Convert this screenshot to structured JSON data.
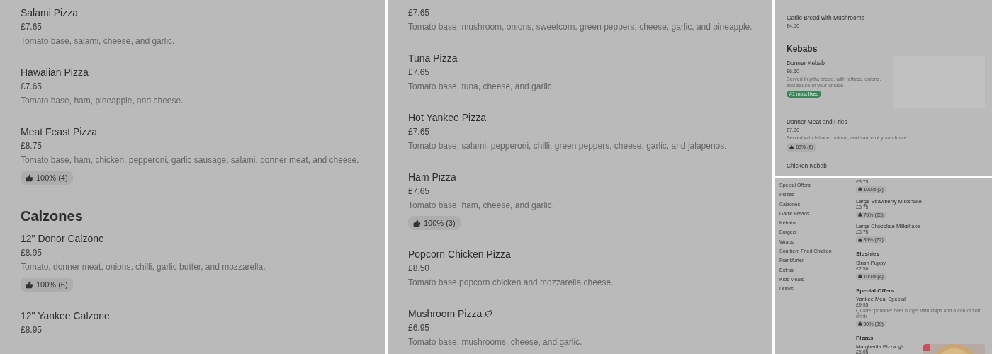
{
  "panels": [
    {
      "kind": "large",
      "sections": [
        {
          "items": [
            {
              "title": "Salami Pizza",
              "price": "£7.65",
              "description": "Tomato base, salami, cheese, and garlic.",
              "vegetarian": false
            },
            {
              "title": "Hawaiian Pizza",
              "price": "£7.65",
              "description": "Tomato base, ham, pineapple, and cheese.",
              "vegetarian": false
            },
            {
              "title": "Meat Feast Pizza",
              "price": "£8.75",
              "description": "Tomato base, ham, chicken, pepperoni, garlic sausage, salami, donner meat, and cheese.",
              "rating": "100% (4)",
              "vegetarian": false
            }
          ]
        },
        {
          "heading": "Calzones",
          "items": [
            {
              "title": "12\" Donor Calzone",
              "price": "£8.95",
              "description": "Tomato, donner meat, onions, chilli, garlic butter, and mozzarella.",
              "rating": "100% (6)",
              "vegetarian": false
            },
            {
              "title": "12\" Yankee Calzone",
              "price": "£8.95",
              "vegetarian": false
            }
          ]
        }
      ]
    },
    {
      "kind": "large",
      "sections": [
        {
          "items": [
            {
              "price": "£7.65",
              "description": "Tomato base, mushroom, onions, sweetcorn, green peppers, cheese, garlic, and pineapple."
            },
            {
              "title": "Tuna Pizza",
              "price": "£7.65",
              "description": "Tomato base, tuna, cheese, and garlic.",
              "vegetarian": false
            },
            {
              "title": "Hot Yankee Pizza",
              "price": "£7.65",
              "description": "Tomato base, salami, pepperoni, chilli, green peppers, cheese, garlic, and jalapenos.",
              "vegetarian": false
            },
            {
              "title": "Ham Pizza",
              "price": "£7.65",
              "description": "Tomato base, ham, cheese, and garlic.",
              "rating": "100% (3)",
              "vegetarian": false
            },
            {
              "title": "Popcorn Chicken Pizza",
              "price": "£8.50",
              "description": "Tomato base popcorn chicken and mozzarella cheese.",
              "vegetarian": false
            },
            {
              "title": "Mushroom Pizza",
              "price": "£6.95",
              "description": "Tomato base, mushrooms, cheese, and garlic.",
              "vegetarian": true
            }
          ]
        }
      ]
    },
    {
      "kind": "compact",
      "sections": [
        {
          "items": [
            {
              "title": "Garlic Bread with Mushrooms",
              "price": "£4.50",
              "vegetarian": false
            }
          ]
        },
        {
          "heading": "Kebabs",
          "items": [
            {
              "title": "Donner Kebab",
              "price": "£6.50",
              "description": "Served in pitta bread, with lettuce, onions, and sauce of your choice.",
              "tag": "#1 most liked",
              "kind": "image-placeholder",
              "vegetarian": false
            },
            {
              "title": "Donner Meat and Fries",
              "price": "£7.80",
              "description": "Served with lettuce, onions, and sauce of your choice.",
              "rating": "83% (6)",
              "vegetarian": false
            },
            {
              "title": "Chicken Kebab",
              "vegetarian": false
            }
          ]
        }
      ]
    },
    {
      "kind": "sidebar",
      "sidebar": [
        "Special Offers",
        "Pizzas",
        "Calzones",
        "Garlic Breads",
        "Kebabs",
        "Burgers",
        "Wraps",
        "Southern Fried Chicken",
        "Frankfurter",
        "Extras",
        "Kids Meals",
        "Drinks"
      ],
      "sections": [
        {
          "items": [
            {
              "price": "£3.75",
              "rating": "100% (3)"
            },
            {
              "title": "Large Strawberry Milkshake",
              "price": "£3.75",
              "rating": "79% (23)",
              "vegetarian": false
            },
            {
              "title": "Large Chocolate Milkshake",
              "price": "£3.75",
              "rating": "85% (22)",
              "vegetarian": false
            }
          ]
        },
        {
          "heading": "Slushies",
          "items": [
            {
              "title": "Slush Puppy",
              "price": "£2.50",
              "rating": "100% (4)",
              "vegetarian": false
            }
          ]
        },
        {
          "heading": "Special Offers",
          "items": [
            {
              "title": "Yankee Meal Special",
              "price": "£9.95",
              "description": "Quarter pounder beef burger with chips and a can of soft drink",
              "rating": "90% (39)",
              "vegetarian": false
            }
          ]
        },
        {
          "heading": "Pizzas",
          "items": [
            {
              "title": "Margherita Pizza",
              "price": "£6.95",
              "kind": "picture",
              "vegetarian": true
            }
          ]
        }
      ]
    }
  ]
}
